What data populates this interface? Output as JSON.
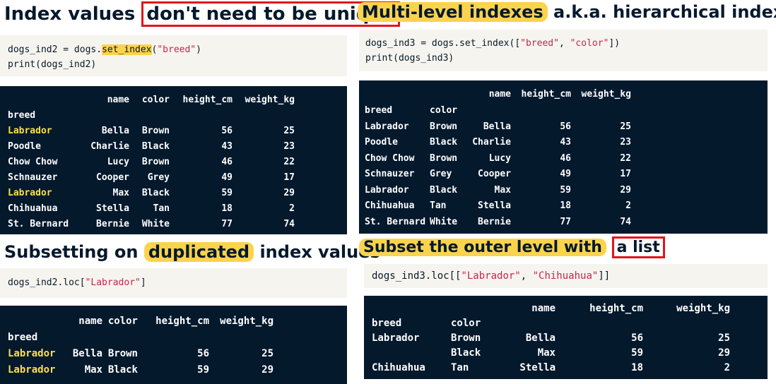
{
  "left": {
    "heading1": {
      "before": "Index values ",
      "boxed": "don't need to be unique"
    },
    "code1": {
      "line1_pre": "dogs_ind2 = dogs.",
      "line1_fn": "set_index",
      "line1_open": "(",
      "line1_str": "\"breed\"",
      "line1_close": ")",
      "line2": "print(dogs_ind2)"
    },
    "out1": {
      "columns": [
        "name",
        "color",
        "height_cm",
        "weight_kg"
      ],
      "index_name": "breed",
      "rows": [
        [
          "Labrador",
          "Bella",
          "Brown",
          "56",
          "25"
        ],
        [
          "Poodle",
          "Charlie",
          "Black",
          "43",
          "23"
        ],
        [
          "Chow Chow",
          "Lucy",
          "Brown",
          "46",
          "22"
        ],
        [
          "Schnauzer",
          "Cooper",
          "Grey",
          "49",
          "17"
        ],
        [
          "Labrador",
          "Max",
          "Black",
          "59",
          "29"
        ],
        [
          "Chihuahua",
          "Stella",
          "Tan",
          "18",
          "2"
        ],
        [
          "St. Bernard",
          "Bernie",
          "White",
          "77",
          "74"
        ]
      ]
    },
    "heading2": {
      "before": "Subsetting on ",
      "highlight": "duplicated",
      "after": " index values"
    },
    "code2": {
      "pre": "dogs_ind2.loc[",
      "str": "\"Labrador\"",
      "post": "]"
    },
    "out2": {
      "columns": [
        "name",
        "color",
        "height_cm",
        "weight_kg"
      ],
      "index_name": "breed",
      "rows": [
        [
          "Labrador",
          "Bella",
          "Brown",
          "56",
          "25"
        ],
        [
          "Labrador",
          "Max",
          "Black",
          "59",
          "29"
        ]
      ]
    }
  },
  "right": {
    "heading1": {
      "highlight": "Multi-level indexes",
      "after": " a.k.a. hierarchical indexes"
    },
    "code1": {
      "line1_pre": "dogs_ind3 = dogs.set_index([",
      "line1_str1": "\"breed\"",
      "line1_sep": ", ",
      "line1_str2": "\"color\"",
      "line1_post": "])",
      "line2": "print(dogs_ind3)"
    },
    "out1": {
      "columns": [
        "name",
        "height_cm",
        "weight_kg"
      ],
      "index_names": [
        "breed",
        "color"
      ],
      "rows": [
        [
          "Labrador",
          "Brown",
          "Bella",
          "56",
          "25"
        ],
        [
          "Poodle",
          "Black",
          "Charlie",
          "43",
          "23"
        ],
        [
          "Chow Chow",
          "Brown",
          "Lucy",
          "46",
          "22"
        ],
        [
          "Schnauzer",
          "Grey",
          "Cooper",
          "49",
          "17"
        ],
        [
          "Labrador",
          "Black",
          "Max",
          "59",
          "29"
        ],
        [
          "Chihuahua",
          "Tan",
          "Stella",
          "18",
          "2"
        ],
        [
          "St. Bernard",
          "White",
          "Bernie",
          "77",
          "74"
        ]
      ]
    },
    "heading2": {
      "highlight": "Subset the outer level with",
      "boxed": "a list"
    },
    "code2": {
      "pre": "dogs_ind3.loc[[",
      "str1": "\"Labrador\"",
      "sep": ", ",
      "str2": "\"Chihuahua\"",
      "post": "]]"
    },
    "out2": {
      "columns": [
        "name",
        "height_cm",
        "weight_kg"
      ],
      "index_names": [
        "breed",
        "color"
      ],
      "rows": [
        [
          "Labrador",
          "Brown",
          "Bella",
          "56",
          "25"
        ],
        [
          "",
          "Black",
          "Max",
          "59",
          "29"
        ],
        [
          "Chihuahua",
          "Tan",
          "Stella",
          "18",
          "2"
        ]
      ]
    }
  }
}
